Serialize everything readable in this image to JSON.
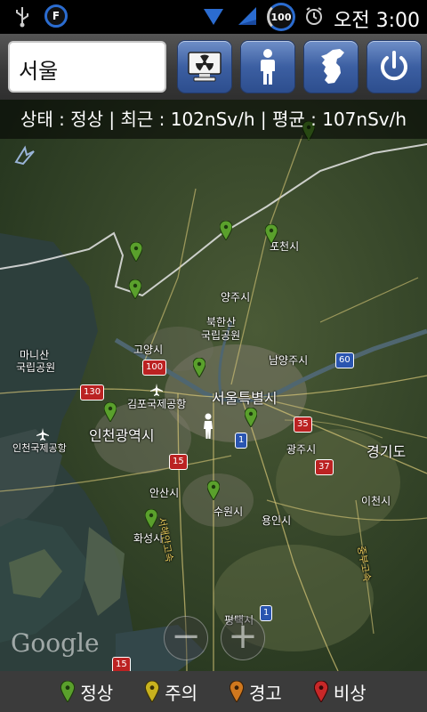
{
  "status_bar": {
    "time": "오전 3:00",
    "app_badge": "F",
    "battery_level": "100",
    "icons": [
      "usb-icon",
      "app-f-icon",
      "wifi-icon",
      "signal-icon",
      "battery-icon",
      "alarm-icon"
    ]
  },
  "toolbar": {
    "search_value": "서울",
    "buttons": [
      "radiation-monitor-icon",
      "person-icon",
      "korea-map-icon",
      "power-icon"
    ]
  },
  "status_line": "상태 : 정상 | 최근 : 102nSv/h | 평균 : 107nSv/h",
  "map": {
    "labels": {
      "pocheon": "포천시",
      "yangju": "양주시",
      "bukhansan": "북한산",
      "bukhansan2": "국립공원",
      "goyang": "고양시",
      "namyangju": "남양주시",
      "manisan": "마니산",
      "manisan2": "국립공원",
      "gimpo_airport": "김포국제공항",
      "seoul": "서울특별시",
      "incheon_city": "인천광역시",
      "incheon_airport": "인천국제공항",
      "gwangju": "광주시",
      "gyeonggi": "경기도",
      "ansan": "안산시",
      "suwon": "수원시",
      "yongin": "용인시",
      "icheon": "이천시",
      "hwaseong": "화성시",
      "pyeongtaek": "평택시",
      "seohaean": "서해안고속",
      "jungbu": "중부고속"
    },
    "shields": {
      "r100": "100",
      "r130": "130",
      "r60": "60",
      "r35": "35",
      "r1a": "1",
      "r15a": "15",
      "r37": "37",
      "r1b": "1",
      "r15b": "15"
    },
    "attribution": "Google",
    "zoom_out": "−",
    "zoom_in": "+"
  },
  "legend": [
    {
      "label": "정상",
      "color": "#5aa02c"
    },
    {
      "label": "주의",
      "color": "#c8b21e"
    },
    {
      "label": "경고",
      "color": "#d0781e"
    },
    {
      "label": "비상",
      "color": "#c82828"
    }
  ],
  "colors": {
    "normal_pin": "#5aa02c",
    "toolbar_button": "#3c5fa2"
  }
}
